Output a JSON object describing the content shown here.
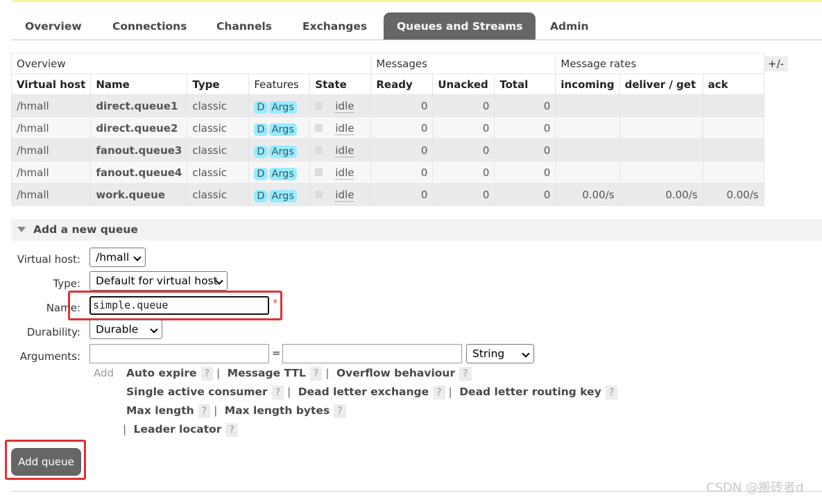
{
  "tabs": [
    "Overview",
    "Connections",
    "Channels",
    "Exchanges",
    "Queues and Streams",
    "Admin"
  ],
  "active_tab": "Queues and Streams",
  "table": {
    "groups": [
      "Overview",
      "Messages",
      "Message rates"
    ],
    "plus_minus": "+/-",
    "headers": [
      "Virtual host",
      "Name",
      "Type",
      "Features",
      "State",
      "Ready",
      "Unacked",
      "Total",
      "incoming",
      "deliver / get",
      "ack"
    ],
    "rows": [
      {
        "vhost": "/hmall",
        "name": "direct.queue1",
        "type": "classic",
        "feat_d": "D",
        "feat_args": "Args",
        "state": "idle",
        "ready": "0",
        "unacked": "0",
        "total": "0",
        "incoming": "",
        "deliver_get": "",
        "ack": ""
      },
      {
        "vhost": "/hmall",
        "name": "direct.queue2",
        "type": "classic",
        "feat_d": "D",
        "feat_args": "Args",
        "state": "idle",
        "ready": "0",
        "unacked": "0",
        "total": "0",
        "incoming": "",
        "deliver_get": "",
        "ack": ""
      },
      {
        "vhost": "/hmall",
        "name": "fanout.queue3",
        "type": "classic",
        "feat_d": "D",
        "feat_args": "Args",
        "state": "idle",
        "ready": "0",
        "unacked": "0",
        "total": "0",
        "incoming": "",
        "deliver_get": "",
        "ack": ""
      },
      {
        "vhost": "/hmall",
        "name": "fanout.queue4",
        "type": "classic",
        "feat_d": "D",
        "feat_args": "Args",
        "state": "idle",
        "ready": "0",
        "unacked": "0",
        "total": "0",
        "incoming": "",
        "deliver_get": "",
        "ack": ""
      },
      {
        "vhost": "/hmall",
        "name": "work.queue",
        "type": "classic",
        "feat_d": "D",
        "feat_args": "Args",
        "state": "idle",
        "ready": "0",
        "unacked": "0",
        "total": "0",
        "incoming": "0.00/s",
        "deliver_get": "0.00/s",
        "ack": "0.00/s"
      }
    ]
  },
  "add_queue": {
    "section_title": "Add a new queue",
    "virtual_host_label": "Virtual host:",
    "virtual_host_value": "/hmall",
    "type_label": "Type:",
    "type_value": "Default for virtual host",
    "name_label": "Name:",
    "name_value": "simple.queue",
    "required_mark": "*",
    "durability_label": "Durability:",
    "durability_value": "Durable",
    "arguments_label": "Arguments:",
    "equals": "=",
    "arg_type_value": "String",
    "add_label": "Add",
    "help_items": [
      "Auto expire",
      "Message TTL",
      "Overflow behaviour",
      "Single active consumer",
      "Dead letter exchange",
      "Dead letter routing key",
      "Max length",
      "Max length bytes",
      "Leader locator"
    ],
    "help_q": "?",
    "separator": "|",
    "submit_label": "Add queue"
  },
  "watermark": "CSDN @搬砖者d",
  "colors": {
    "tab_active": "#666666",
    "feature_tag": "#99ebff",
    "highlight_box": "#e03131"
  }
}
